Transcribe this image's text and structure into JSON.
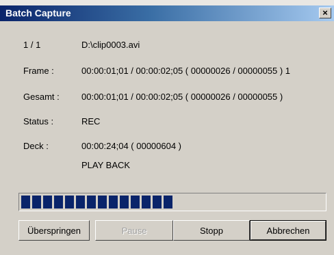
{
  "dialog": {
    "title": "Batch Capture",
    "close_symbol": "×"
  },
  "info": {
    "counter": "1 / 1",
    "file": "D:\\clip0003.avi",
    "frame_label": "Frame :",
    "frame_value": "00:00:01;01 / 00:00:02;05 ( 00000026 / 00000055 ) 1",
    "total_label": "Gesamt :",
    "total_value": "00:00:01;01 / 00:00:02;05 ( 00000026 / 00000055 )",
    "status_label": "Status :",
    "status_value": "REC",
    "deck_label": "Deck :",
    "deck_value": "00:00:24;04 ( 00000604 )",
    "deck_mode": "PLAY BACK"
  },
  "progress": {
    "filled_blocks": 14,
    "percent": 47
  },
  "buttons": {
    "skip": "Überspringen",
    "pause": "Pause",
    "stop": "Stopp",
    "cancel": "Abbrechen"
  },
  "colors": {
    "titlebar_start": "#0a246a",
    "titlebar_end": "#a6caf0",
    "progress_fill": "#0a246a",
    "dialog_bg": "#d4d0c8"
  }
}
